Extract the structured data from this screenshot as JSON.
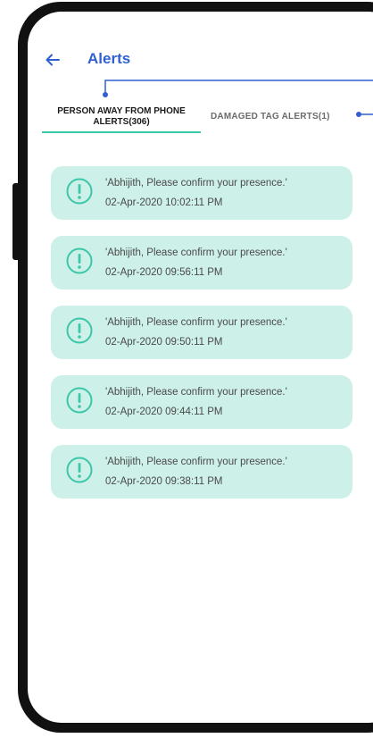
{
  "header": {
    "title": "Alerts",
    "back_icon": "arrow-left-icon",
    "accent_color": "#2f5fd0"
  },
  "tabs": [
    {
      "label": "PERSON AWAY FROM PHONE ALERTS(306)",
      "selected": true
    },
    {
      "label": "DAMAGED TAG ALERTS(1)",
      "selected": false
    }
  ],
  "alerts": [
    {
      "message": "'Abhijith, Please confirm your presence.'",
      "timestamp": "02-Apr-2020 10:02:11 PM"
    },
    {
      "message": "'Abhijith, Please confirm your presence.'",
      "timestamp": "02-Apr-2020 09:56:11 PM"
    },
    {
      "message": "'Abhijith, Please confirm your presence.'",
      "timestamp": "02-Apr-2020 09:50:11 PM"
    },
    {
      "message": "'Abhijith, Please confirm your presence.'",
      "timestamp": "02-Apr-2020 09:44:11 PM"
    },
    {
      "message": "'Abhijith, Please confirm your presence.'",
      "timestamp": "02-Apr-2020 09:38:11 PM"
    }
  ],
  "colors": {
    "card_background": "#cdf0e9",
    "tab_indicator": "#3cc7a8",
    "alert_icon": "#3cc7a8",
    "annotation_line": "#2f5fd0",
    "phone_frame": "#111111"
  }
}
